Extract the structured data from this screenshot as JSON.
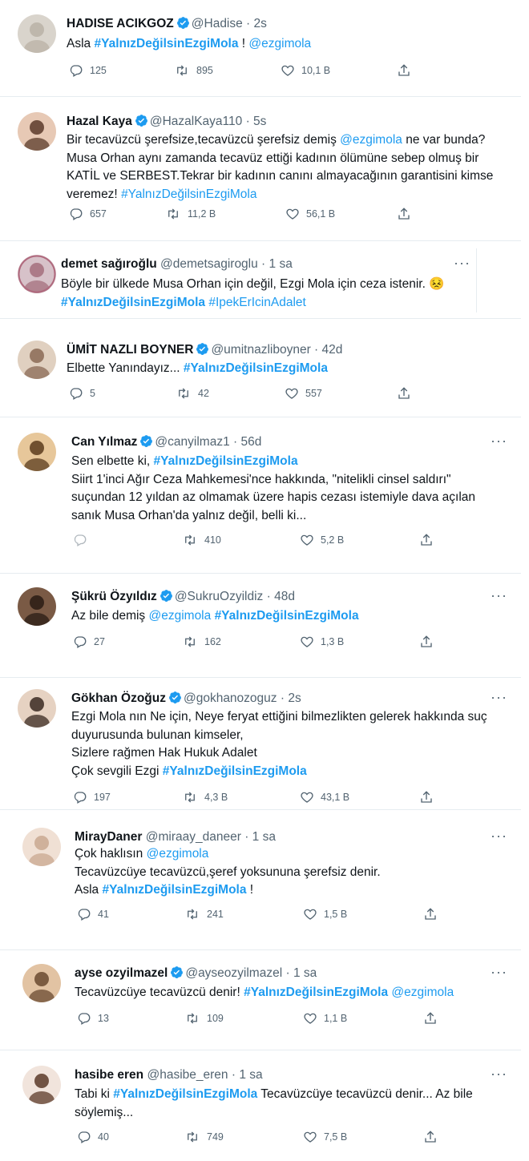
{
  "colors": {
    "link": "#1d9bf0",
    "text": "#0f1419",
    "muted": "#536471",
    "verified": "#1d9bf0"
  },
  "tweets": [
    {
      "name": "HADISE ACIKGOZ",
      "handle": "@Hadise",
      "time": "2s",
      "verified": true,
      "lines": [
        [
          "Asla ",
          {
            "h": "#YalnızDeğilsinEzgiMola"
          },
          " ! ",
          {
            "l": "@ezgimola"
          }
        ]
      ],
      "reply": "125",
      "retweet": "895",
      "like": "10,1 B"
    },
    {
      "name": "Hazal Kaya",
      "handle": "@HazalKaya110",
      "time": "5s",
      "verified": true,
      "lines": [
        [
          "Bir tecavüzcü şerefsize,tecavüzcü şerefsiz demiş ",
          {
            "l": "@ezgimola"
          },
          " ne var bunda?"
        ],
        [
          "Musa Orhan aynı zamanda tecavüz ettiği kadının ölümüne sebep olmuş bir"
        ],
        [
          "KATİL ve SERBEST.Tekrar bir kadının canını almayacağının garantisini kimse"
        ],
        [
          "veremez! ",
          {
            "l": "#YalnızDeğilsinEzgiMola"
          }
        ]
      ],
      "reply": "657",
      "retweet": "11,2 B",
      "like": "56,1 B"
    },
    {
      "name": "demet sağıroğlu",
      "handle": "@demetsagiroglu",
      "time": "1 sa",
      "verified": false,
      "lines": [
        [
          "Böyle bir ülkede Musa Orhan için değil, Ezgi Mola için ceza istenir. 😣"
        ],
        [
          {
            "h": "#YalnızDeğilsinEzgiMola"
          },
          " ",
          {
            "l": "#IpekErIcinAdalet"
          }
        ]
      ]
    },
    {
      "name": "ÜMİT NAZLI BOYNER",
      "handle": "@umitnazliboyner",
      "time": "42d",
      "verified": true,
      "lines": [
        [
          "Elbette Yanındayız... ",
          {
            "h": "#YalnızDeğilsinEzgiMola"
          }
        ]
      ],
      "reply": "5",
      "retweet": "42",
      "like": "557"
    },
    {
      "name": "Can Yılmaz",
      "handle": "@canyilmaz1",
      "time": "56d",
      "verified": true,
      "lines": [
        [
          "Sen elbette ki, ",
          {
            "h": "#YalnızDeğilsinEzgiMola"
          }
        ],
        [
          "Siirt 1'inci Ağır Ceza Mahkemesi'nce hakkında, \"nitelikli cinsel saldırı\""
        ],
        [
          "suçundan 12 yıldan az olmamak üzere hapis cezası istemiyle dava açılan"
        ],
        [
          "sanık Musa Orhan'da yalnız değil, belli ki..."
        ]
      ],
      "reply": "",
      "retweet": "410",
      "like": "5,2 B"
    },
    {
      "name": "Şükrü Özyıldız",
      "handle": "@SukruOzyildiz",
      "time": "48d",
      "verified": true,
      "lines": [
        [
          "Az bile demiş ",
          {
            "l": "@ezgimola"
          },
          " ",
          {
            "h": "#YalnızDeğilsinEzgiMola"
          }
        ]
      ],
      "reply": "27",
      "retweet": "162",
      "like": "1,3 B"
    },
    {
      "name": "Gökhan Özoğuz",
      "handle": "@gokhanozoguz",
      "time": "2s",
      "verified": true,
      "lines": [
        [
          "Ezgi Mola nın Ne için, Neye feryat ettiğini bilmezlikten gelerek hakkında suç"
        ],
        [
          "duyurusunda bulunan kimseler,"
        ],
        [
          "Sizlere rağmen Hak Hukuk Adalet"
        ],
        [
          "Çok sevgili Ezgi ",
          {
            "h": "#YalnızDeğilsinEzgiMola"
          }
        ]
      ],
      "reply": "197",
      "retweet": "4,3 B",
      "like": "43,1 B"
    },
    {
      "name": "MirayDaner",
      "handle": "@miraay_daneer",
      "time": "1 sa",
      "verified": false,
      "lines": [
        [
          "Çok haklısın ",
          {
            "l": "@ezgimola"
          }
        ],
        [
          "Tecavüzcüye tecavüzcü,şeref yoksununa şerefsiz denir."
        ],
        [
          "Asla ",
          {
            "h": "#YalnızDeğilsinEzgiMola"
          },
          " !"
        ]
      ],
      "reply": "41",
      "retweet": "241",
      "like": "1,5 B"
    },
    {
      "name": "ayse ozyilmazel",
      "handle": "@ayseozyilmazel",
      "time": "1 sa",
      "verified": true,
      "lines": [
        [
          "Tecavüzcüye tecavüzcü denir! ",
          {
            "h": "#YalnızDeğilsinEzgiMola"
          },
          " ",
          {
            "l": "@ezgimola"
          }
        ]
      ],
      "reply": "13",
      "retweet": "109",
      "like": "1,1 B"
    },
    {
      "name": "hasibe eren",
      "handle": "@hasibe_eren",
      "time": "1 sa",
      "verified": false,
      "lines": [
        [
          "Tabi ki ",
          {
            "h": "#YalnızDeğilsinEzgiMola"
          },
          " Tecavüzcüye tecavüzcü denir... Az bile"
        ],
        [
          "söylemiş..."
        ]
      ],
      "reply": "40",
      "retweet": "749",
      "like": "7,5 B"
    }
  ]
}
